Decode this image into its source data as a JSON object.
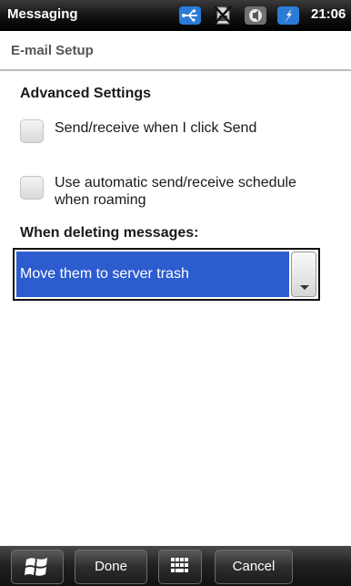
{
  "status_bar": {
    "app_name": "Messaging",
    "time": "21:06",
    "icons": [
      "usb-sync-icon",
      "no-sim-icon",
      "volume-icon",
      "charging-icon"
    ]
  },
  "header": {
    "title": "E-mail Setup"
  },
  "advanced": {
    "heading": "Advanced Settings",
    "send_receive_label": "Send/receive when I click Send",
    "send_receive_checked": false,
    "roaming_label_line1": "Use automatic send/receive schedule",
    "roaming_label_line2": "when roaming",
    "roaming_checked": false
  },
  "deleting": {
    "heading": "When deleting messages:",
    "selected": "Move them to server trash"
  },
  "bottom_bar": {
    "done_label": "Done",
    "cancel_label": "Cancel"
  },
  "colors": {
    "selection_blue": "#2d5ccf",
    "accent_blue": "#2b7bd6"
  }
}
